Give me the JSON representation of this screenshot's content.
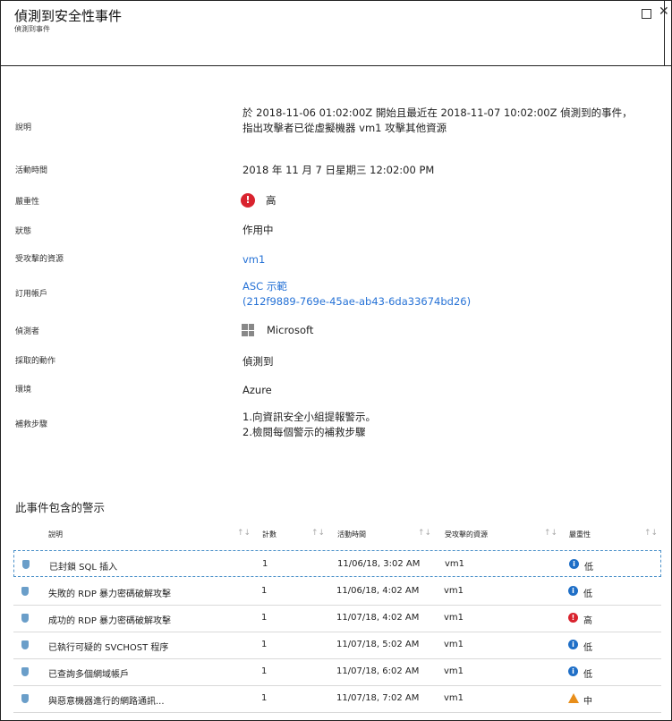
{
  "window": {
    "title": "偵測到安全性事件",
    "subtitle": "偵測到事件",
    "maximize_glyph": "☐",
    "close_glyph": "✕"
  },
  "details": {
    "description_label": "說明",
    "description_line1": "於 2018-11-06 01:02:00Z 開始且最近在 2018-11-07 10:02:00Z 偵測到的事件，",
    "description_line2": "指出攻擊者已從虛擬機器 vm1 攻擊其他資源",
    "activity_time_label": "活動時間",
    "activity_time": "2018 年 11 月 7 日星期三 12:02:00 PM",
    "severity_label": "嚴重性",
    "severity": "高",
    "state_label": "狀態",
    "state": "作用中",
    "attacked_resource_label": "受攻擊的資源",
    "attacked_resource": "vm1",
    "subscription_label": "訂用帳戶",
    "subscription_name": "ASC 示範",
    "subscription_id": "(212f9889-769e-45ae-ab43-6da33674bd26)",
    "detected_by_label": "偵測者",
    "detected_by": "Microsoft",
    "action_taken_label": "採取的動作",
    "action_taken": "偵測到",
    "environment_label": "環境",
    "environment": "Azure",
    "remediation_label": "補救步驟",
    "remediation_line1": "1.向資訊安全小組提報警示。",
    "remediation_line2": "2.檢閱每個警示的補救步驟"
  },
  "alerts": {
    "section_title": "此事件包含的警示",
    "headers": {
      "description": "說明",
      "count": "計數",
      "activity_time": "活動時間",
      "attacked_resource": "受攻擊的資源",
      "severity": "嚴重性"
    },
    "sort_glyph": "↑↓",
    "rows": [
      {
        "description": "已封鎖 SQL 插入",
        "count": "1",
        "time": "11/06/18, 3:02 AM",
        "resource": "vm1",
        "severity": "低",
        "level": "info"
      },
      {
        "description": "失敗的 RDP 暴力密碼破解攻擊",
        "count": "1",
        "time": "11/06/18, 4:02 AM",
        "resource": "vm1",
        "severity": "低",
        "level": "info"
      },
      {
        "description": "成功的 RDP 暴力密碼破解攻擊",
        "count": "1",
        "time": "11/07/18, 4:02 AM",
        "resource": "vm1",
        "severity": "高",
        "level": "high"
      },
      {
        "description": "已執行可疑的 SVCHOST 程序",
        "count": "1",
        "time": "11/07/18, 5:02 AM",
        "resource": "vm1",
        "severity": "低",
        "level": "info"
      },
      {
        "description": "已查詢多個網域帳戶",
        "count": "1",
        "time": "11/07/18, 6:02 AM",
        "resource": "vm1",
        "severity": "低",
        "level": "info"
      },
      {
        "description": "與惡意機器進行的網路通訊...",
        "count": "1",
        "time": "11/07/18, 7:02 AM",
        "resource": "vm1",
        "severity": "中",
        "level": "medium"
      }
    ]
  },
  "colors": {
    "link": "#2672d6",
    "severity_high": "#d9232e",
    "severity_info": "#1f6fc7",
    "severity_medium": "#e88e1a"
  },
  "icons": {
    "severity_high": "error-icon",
    "severity_low": "info-icon",
    "severity_medium": "warning-icon",
    "alert_row": "shield-icon",
    "detected_by": "windows-logo-icon"
  }
}
